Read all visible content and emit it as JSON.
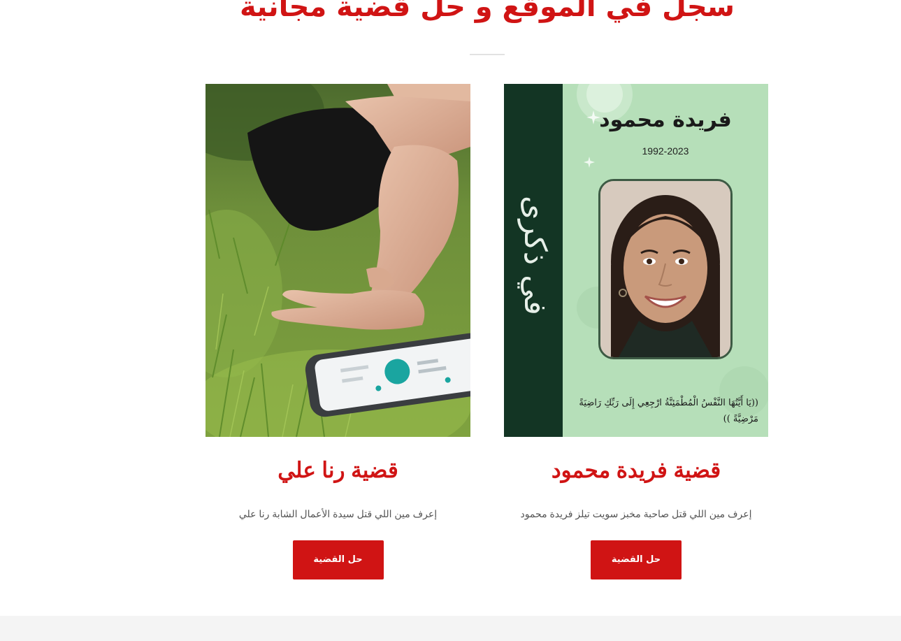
{
  "header": {
    "title": "سجل في الموقع و حل قضية مجانية"
  },
  "cards": [
    {
      "title": "قضية رنا علي",
      "description": "إعرف مين اللي قتل سيدة الأعمال الشابة رنا علي",
      "button_label": "حل القضية",
      "image_alt": "hand on grass next to a smartphone"
    },
    {
      "title": "قضية فريدة محمود",
      "description": "إعرف مين اللي قتل صاحبة مخبز سويت تيلز فريدة محمود",
      "button_label": "حل القضية",
      "poster": {
        "vertical_text": "في ذكرى",
        "name": "فريدة محمود",
        "years": "1992-2023",
        "verse_line1": "((يَا أَيَّتُهَا النَّفْسُ الْمُطْمَئِنَّةُ ارْجِعِي إِلَى رَبِّكِ رَاضِيَةً",
        "verse_line2": "مَرْضِيَّةً ))"
      }
    }
  ],
  "colors": {
    "accent": "#d01414",
    "poster_dark": "#133524",
    "poster_light": "#b6dfb9",
    "footer_band": "#f4f4f4"
  }
}
